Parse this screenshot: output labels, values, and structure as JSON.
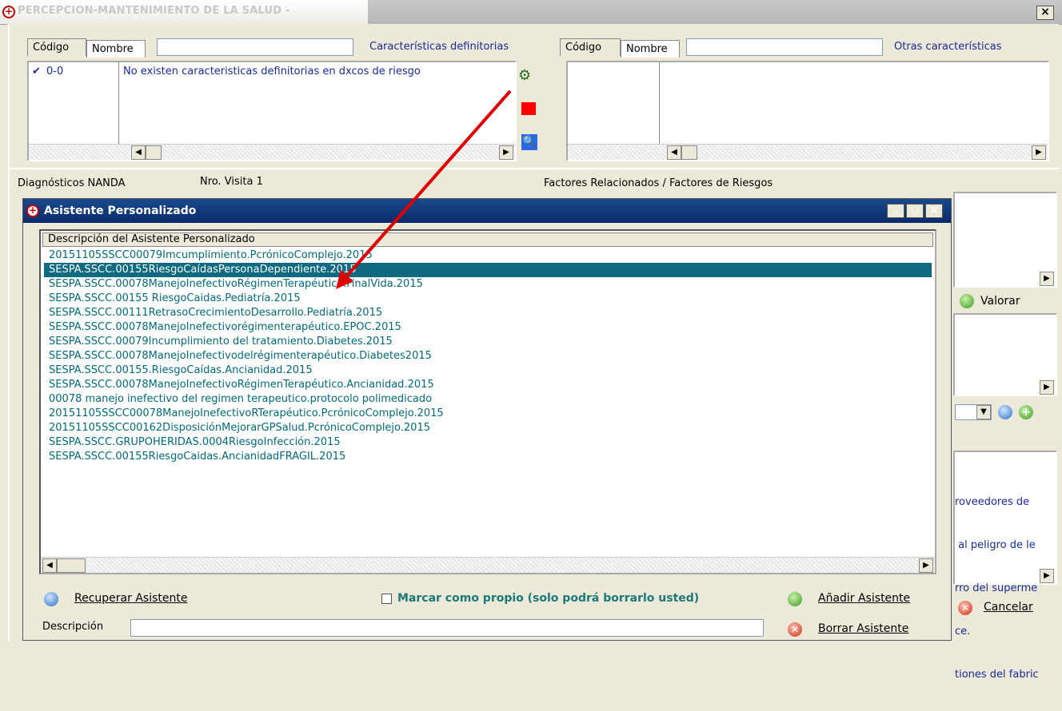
{
  "window": {
    "title": "PERCEPCION-MANTENIMIENTO DE LA SALUD -",
    "close": "×"
  },
  "left_panel": {
    "tab_codigo": "Código",
    "tab_nombre": "Nombre",
    "heading": "Características definitorias",
    "row_code": "0-0",
    "row_text": "No existen caracteristicas definitorias en dxcos de riesgo"
  },
  "right_panel": {
    "tab_codigo": "Código",
    "tab_nombre": "Nombre",
    "heading": "Otras características"
  },
  "mid": {
    "diagnosticos_label": "Diagnósticos NANDA",
    "visita_label": "Nro. Visita 1",
    "factores_label": "Factores Relacionados / Factores de Riesgos"
  },
  "background_right": {
    "valorar": "Valorar",
    "cancelar": "Cancelar",
    "text_lines": [
      "roveedores de",
      " al peligro de le",
      "rro del superme",
      "ce.",
      "tiones del fabric"
    ]
  },
  "dialog": {
    "title": "Asistente Personalizado",
    "column_header": "Descripción del Asistente Personalizado",
    "items": [
      "20151105SSCC00079Imcumplimiento.PcrónicoComplejo.2015",
      "SESPA.SSCC.00155RiesgoCaídasPersonaDependiente.2015",
      "SESPA.SSCC.00078ManejoInefectivoRégimenTerapéutico.FinalVida.2015",
      "SESPA.SSCC.00155 RiesgoCaidas.Pediatría.2015",
      "SESPA.SSCC.00111RetrasoCrecimientoDesarrollo.Pediatría.2015",
      "SESPA.SSCC.00078ManejoInefectivorégimenterapéutico.EPOC.2015",
      "SESPA.SSCC.00079Incumplimiento del tratamiento.Diabetes.2015",
      "SESPA.SSCC.00078ManejoInefectivodelrégimenterapéutico.Diabetes2015",
      "SESPA.SSCC.00155.RiesgoCaídas.Ancianidad.2015",
      "SESPA.SSCC.00078ManejoInefectivoRégimenTerapéutico.Ancianidad.2015",
      "00078 manejo inefectivo del regimen terapeutico.protocolo polimedicado",
      "20151105SSCC00078ManejoInefectivoRTerapéutico.PcrónicoComplejo.2015",
      "20151105SSCC00162DisposiciónMejorarGPSalud.PcrónicoComplejo.2015",
      "SESPA.SSCC.GRUPOHERIDAS.0004RiesgoInfección.2015",
      "SESPA.SSCC.00155RiesgoCaidas.AncianidadFRAGIL.2015"
    ],
    "selected_index": 1,
    "recuperar": "Recuperar Asistente",
    "marcar": "Marcar como propio (solo podrá borrarlo usted)",
    "anadir": "Añadir Asistente",
    "borrar": "Borrar Asistente",
    "descripcion_label": "Descripción",
    "descripcion_value": ""
  },
  "colors": {
    "list_text": "#006b7a",
    "selected_row": "#0e6a80",
    "title_bar": "#0a2a6a",
    "arrow": "#e00000"
  }
}
